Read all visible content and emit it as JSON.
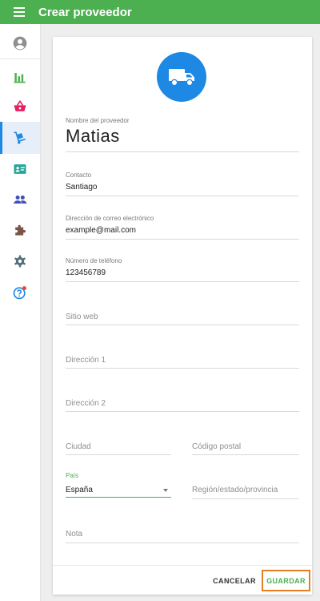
{
  "topbar": {
    "title": "Crear proveedor",
    "menu_icon": "menu-icon"
  },
  "sidebar": {
    "items": [
      {
        "key": "account",
        "icon": "account-circle-icon",
        "color": "#8f8f8f",
        "active": false
      },
      {
        "key": "reports",
        "icon": "bar-chart-icon",
        "color": "#4caf50",
        "active": false
      },
      {
        "key": "sales",
        "icon": "basket-icon",
        "color": "#e91e63",
        "active": false
      },
      {
        "key": "suppliers",
        "icon": "dolly-icon",
        "color": "#1e88e5",
        "active": true
      },
      {
        "key": "contacts",
        "icon": "contact-card-icon",
        "color": "#26a69a",
        "active": false
      },
      {
        "key": "people",
        "icon": "people-icon",
        "color": "#3f51b5",
        "active": false
      },
      {
        "key": "addons",
        "icon": "puzzle-icon",
        "color": "#795548",
        "active": false
      },
      {
        "key": "settings",
        "icon": "gear-icon",
        "color": "#546e7a",
        "active": false
      },
      {
        "key": "help",
        "icon": "help-icon",
        "color": "#1e88e5",
        "active": false,
        "badge_color": "#f44336"
      }
    ]
  },
  "form": {
    "header_icon": "truck-icon",
    "accent_color": "#1e88e5",
    "name": {
      "label": "Nombre del proveedor",
      "value": "Matias"
    },
    "contact": {
      "label": "Contacto",
      "value": "Santiago"
    },
    "email": {
      "label": "Dirección de correo electrónico",
      "value": "example@mail.com"
    },
    "phone": {
      "label": "Número de teléfono",
      "value": "123456789"
    },
    "website": {
      "placeholder": "Sitio web"
    },
    "address1": {
      "placeholder": "Dirección 1"
    },
    "address2": {
      "placeholder": "Dirección 2"
    },
    "city": {
      "placeholder": "Ciudad"
    },
    "postal_code": {
      "placeholder": "Código postal"
    },
    "country": {
      "label": "País",
      "value": "España"
    },
    "region": {
      "placeholder": "Región/estado/provincia"
    },
    "note": {
      "placeholder": "Nota"
    }
  },
  "actions": {
    "cancel_label": "CANCELAR",
    "save_label": "GUARDAR"
  },
  "colors": {
    "primary_green": "#4caf50",
    "focus_outline": "#e67e22"
  }
}
